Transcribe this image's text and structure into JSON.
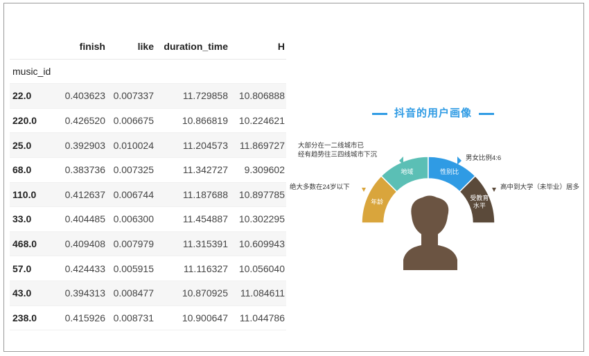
{
  "table": {
    "columns": [
      "finish",
      "like",
      "duration_time",
      "H"
    ],
    "index_name": "music_id",
    "rows": [
      {
        "id": "22.0",
        "finish": "0.403623",
        "like": "0.007337",
        "duration_time": "11.729858",
        "H": "10.806888"
      },
      {
        "id": "220.0",
        "finish": "0.426520",
        "like": "0.006675",
        "duration_time": "10.866819",
        "H": "10.224621"
      },
      {
        "id": "25.0",
        "finish": "0.392903",
        "like": "0.010024",
        "duration_time": "11.204573",
        "H": "11.869727"
      },
      {
        "id": "68.0",
        "finish": "0.383736",
        "like": "0.007325",
        "duration_time": "11.342727",
        "H": "9.309602"
      },
      {
        "id": "110.0",
        "finish": "0.412637",
        "like": "0.006744",
        "duration_time": "11.187688",
        "H": "10.897785"
      },
      {
        "id": "33.0",
        "finish": "0.404485",
        "like": "0.006300",
        "duration_time": "11.454887",
        "H": "10.302295"
      },
      {
        "id": "468.0",
        "finish": "0.409408",
        "like": "0.007979",
        "duration_time": "11.315391",
        "H": "10.609943"
      },
      {
        "id": "57.0",
        "finish": "0.424433",
        "like": "0.005915",
        "duration_time": "11.116327",
        "H": "10.056040"
      },
      {
        "id": "43.0",
        "finish": "0.394313",
        "like": "0.008477",
        "duration_time": "10.870925",
        "H": "11.084611"
      },
      {
        "id": "238.0",
        "finish": "0.415926",
        "like": "0.008731",
        "duration_time": "10.900647",
        "H": "11.044786"
      }
    ]
  },
  "infographic": {
    "title": "抖音的用户画像",
    "segments": [
      {
        "label": "年龄",
        "color": "#d9a53c"
      },
      {
        "label": "地域",
        "color": "#5bbfb5"
      },
      {
        "label": "性别比",
        "color": "#2f9be4"
      },
      {
        "label": "受教育水平",
        "color": "#5b4a3a"
      }
    ],
    "annotations": {
      "region": "大部分在一二线城市已经有趋势往三四线城市下沉",
      "gender": "男女比例4:6",
      "age": "绝大多数在24岁以下",
      "education": "高中到大学（未毕业）居多"
    },
    "silhouette_color": "#6b5442"
  }
}
